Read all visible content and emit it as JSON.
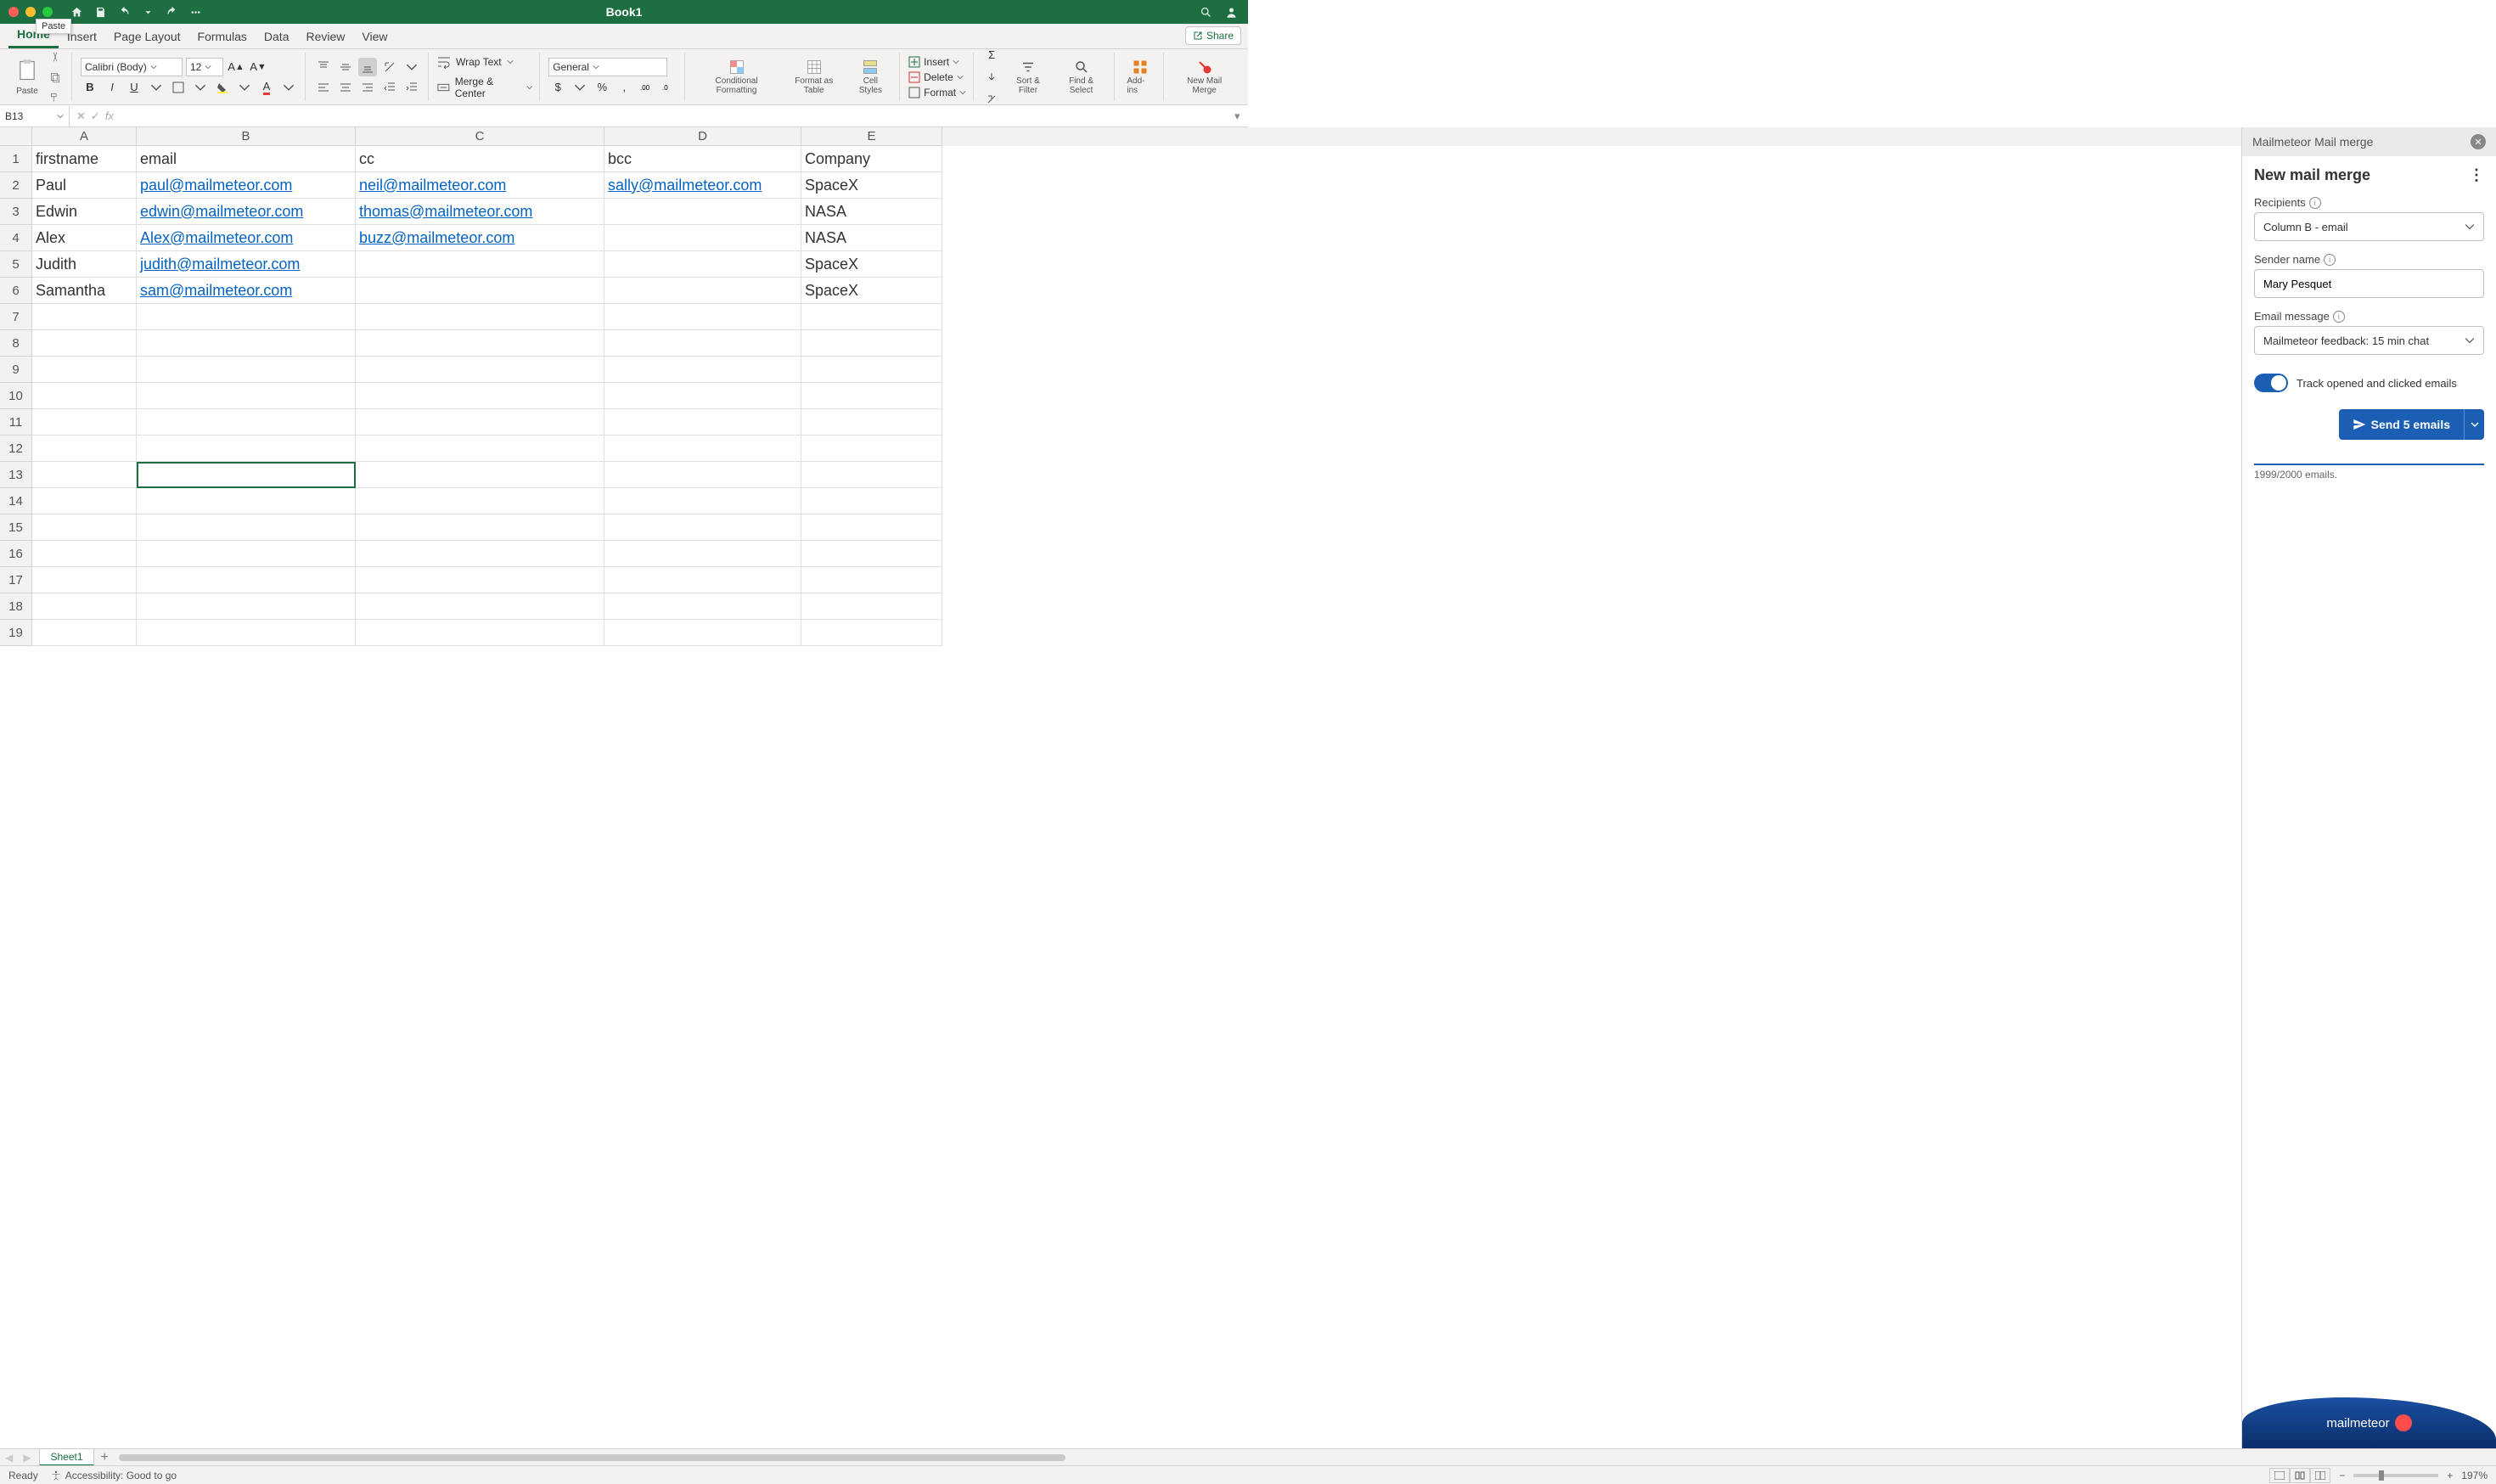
{
  "titlebar": {
    "doc_title": "Book1",
    "tooltip": "Paste"
  },
  "tabs": [
    "Home",
    "Insert",
    "Page Layout",
    "Formulas",
    "Data",
    "Review",
    "View"
  ],
  "active_tab": "Home",
  "share_label": "Share",
  "ribbon": {
    "paste": "Paste",
    "font_name": "Calibri (Body)",
    "font_size": "12",
    "wrap_text": "Wrap Text",
    "merge_center": "Merge & Center",
    "number_format": "General",
    "cond_fmt": "Conditional Formatting",
    "fmt_table": "Format as Table",
    "cell_styles": "Cell Styles",
    "insert": "Insert",
    "delete": "Delete",
    "format": "Format",
    "sort_filter": "Sort & Filter",
    "find_select": "Find & Select",
    "addins": "Add-ins",
    "new_mail_merge": "New Mail Merge"
  },
  "namebox": "B13",
  "columns": [
    "A",
    "B",
    "C",
    "D",
    "E"
  ],
  "col_widths": {
    "A": 123,
    "B": 258,
    "C": 293,
    "D": 232,
    "E": 166
  },
  "headers": {
    "A": "firstname",
    "B": "email",
    "C": "cc",
    "D": "bcc",
    "E": "Company"
  },
  "data_rows": [
    {
      "A": "Paul",
      "B": "paul@mailmeteor.com",
      "C": "neil@mailmeteor.com",
      "D": "sally@mailmeteor.com",
      "E": "SpaceX"
    },
    {
      "A": "Edwin",
      "B": "edwin@mailmeteor.com",
      "C": "thomas@mailmeteor.com",
      "D": "",
      "E": "NASA"
    },
    {
      "A": "Alex",
      "B": "Alex@mailmeteor.com",
      "C": "buzz@mailmeteor.com",
      "D": "",
      "E": "NASA"
    },
    {
      "A": "Judith",
      "B": "judith@mailmeteor.com",
      "C": "",
      "D": "",
      "E": "SpaceX"
    },
    {
      "A": "Samantha",
      "B": "sam@mailmeteor.com",
      "C": "",
      "D": "",
      "E": "SpaceX"
    }
  ],
  "total_rows_shown": 19,
  "selected_cell": {
    "row": 13,
    "col": "B"
  },
  "sidebar": {
    "header": "Mailmeteor Mail merge",
    "title": "New mail merge",
    "recipients_label": "Recipients",
    "recipients_value": "Column B - email",
    "sender_label": "Sender name",
    "sender_value": "Mary Pesquet",
    "message_label": "Email message",
    "message_value": "Mailmeteor feedback: 15 min chat",
    "track_label": "Track opened and clicked emails",
    "send_label": "Send 5 emails",
    "quota": "1999/2000 emails.",
    "brand": "mailmeteor"
  },
  "sheet_tab": "Sheet1",
  "status": {
    "ready": "Ready",
    "acc": "Accessibility: Good to go",
    "zoom": "197%"
  }
}
